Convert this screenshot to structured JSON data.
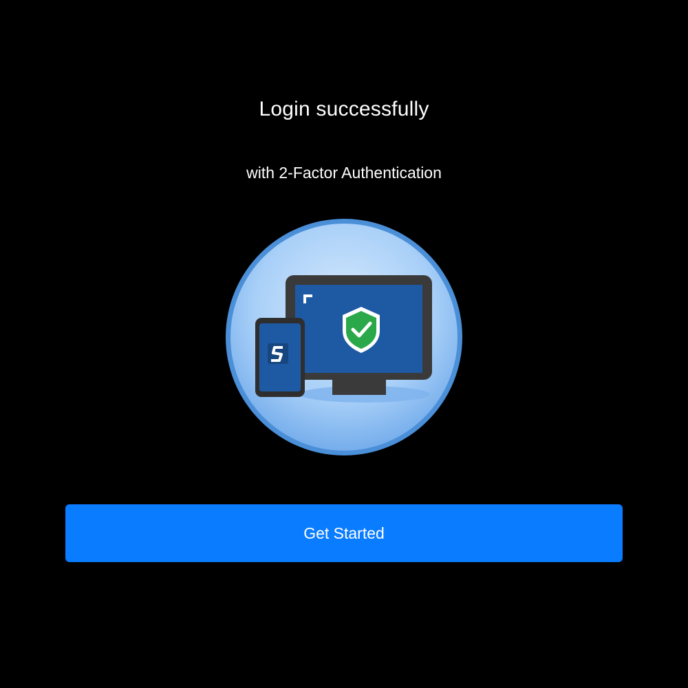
{
  "header": {
    "title": "Login successfully",
    "subtitle": "with 2-Factor Authentication"
  },
  "illustration": {
    "icons": [
      "monitor-icon",
      "phone-icon",
      "shield-check-icon",
      "app-logo-icon"
    ],
    "colors": {
      "circle_outer": "#4a8fd8",
      "circle_inner": "#a9d0f8",
      "device_frame": "#3a3a3a",
      "screen": "#1e5aa3",
      "shield": "#2aa84a"
    }
  },
  "actions": {
    "primary_label": "Get Started",
    "primary_color": "#0a7cff"
  }
}
